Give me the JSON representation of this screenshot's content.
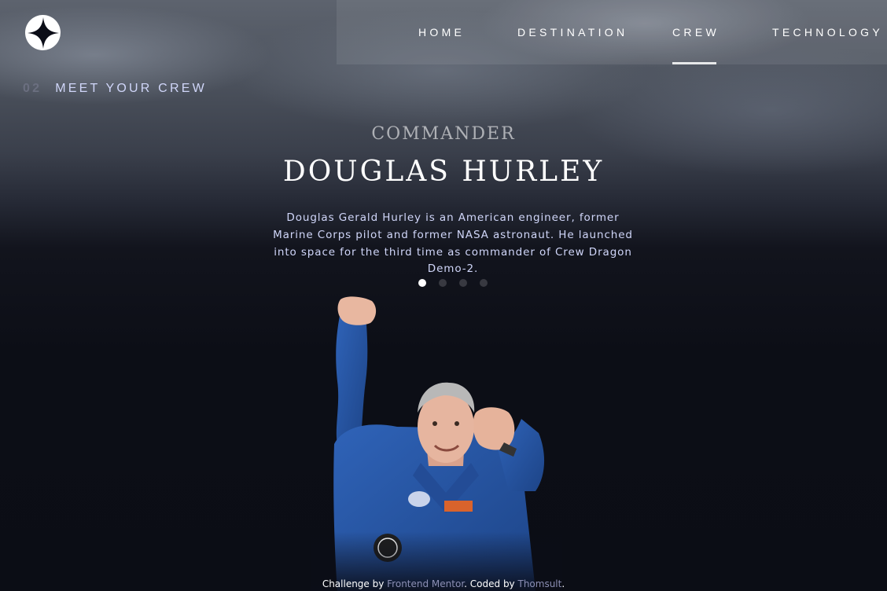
{
  "logo": {
    "icon": "star-logo-icon"
  },
  "nav": {
    "items": [
      {
        "label": "HOME",
        "active": false
      },
      {
        "label": "DESTINATION",
        "active": false
      },
      {
        "label": "CREW",
        "active": true
      },
      {
        "label": "TECHNOLOGY",
        "active": false
      }
    ]
  },
  "heading": {
    "number": "02",
    "title": "MEET YOUR CREW"
  },
  "crew": {
    "role": "COMMANDER",
    "name": "DOUGLAS HURLEY",
    "bio": "Douglas Gerald Hurley is an American engineer, former Marine Corps pilot and former NASA astronaut. He launched into space for the third time as commander of Crew Dragon Demo-2.",
    "slides": 4,
    "active_slide": 1
  },
  "footer": {
    "prefix": "Challenge by ",
    "link1": "Frontend Mentor",
    "middle": ". Coded by ",
    "link2": "Thomsult",
    "suffix": "."
  },
  "colors": {
    "background": "#0b0d17",
    "text": "#ffffff",
    "muted": "#d0d6f9",
    "suit": "#2a56a5"
  }
}
